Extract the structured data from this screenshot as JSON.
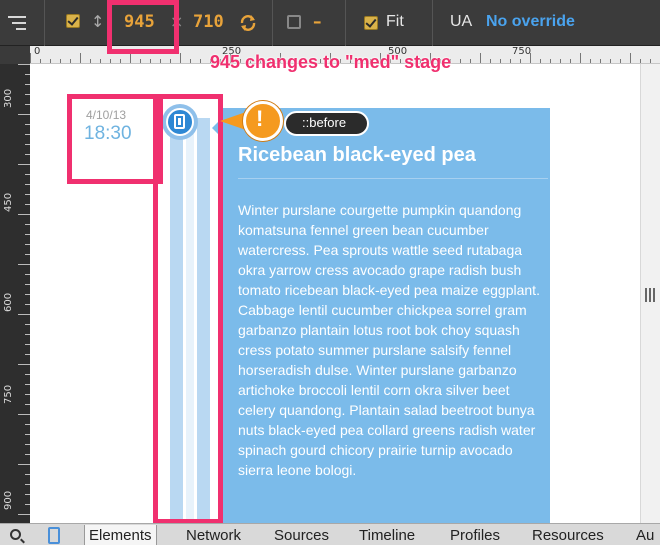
{
  "toolbar": {
    "width_value": "945",
    "height_value": "710",
    "times_symbol": "×",
    "dash_value": "–",
    "fit_label": "Fit",
    "ua_label": "UA",
    "override_label": "No override",
    "arrow_glyph": "↕"
  },
  "ruler": {
    "h_labels": [
      "0",
      "250",
      "500",
      "750"
    ],
    "v_labels": [
      "300",
      "450",
      "600",
      "750",
      "900"
    ]
  },
  "annotation": {
    "callout": "945 changes to \"med\" stage",
    "warning_mark": "!",
    "pseudo_label": "::before"
  },
  "timeline": {
    "date": "4/10/13",
    "time": "18:30"
  },
  "card": {
    "title": "Ricebean black-eyed pea",
    "body": "Winter purslane courgette pumpkin quandong komatsuna fennel green bean cucumber watercress. Pea sprouts wattle seed rutabaga okra yarrow cress avocado grape radish bush tomato ricebean black-eyed pea maize eggplant. Cabbage lentil cucumber chickpea sorrel gram garbanzo plantain lotus root bok choy squash cress potato summer purslane salsify fennel horseradish dulse. Winter purslane garbanzo artichoke broccoli lentil corn okra silver beet celery quandong. Plantain salad beetroot bunya nuts black-eyed pea collard greens radish water spinach gourd chicory prairie turnip avocado sierra leone bologi."
  },
  "tabs": [
    "Elements",
    "Network",
    "Sources",
    "Timeline",
    "Profiles",
    "Resources",
    "Au"
  ],
  "colors": {
    "accent_orange": "#e8a33a",
    "highlight_pink": "#f0306f",
    "card_blue": "#7bbbea",
    "link_blue": "#4aa3ee"
  }
}
